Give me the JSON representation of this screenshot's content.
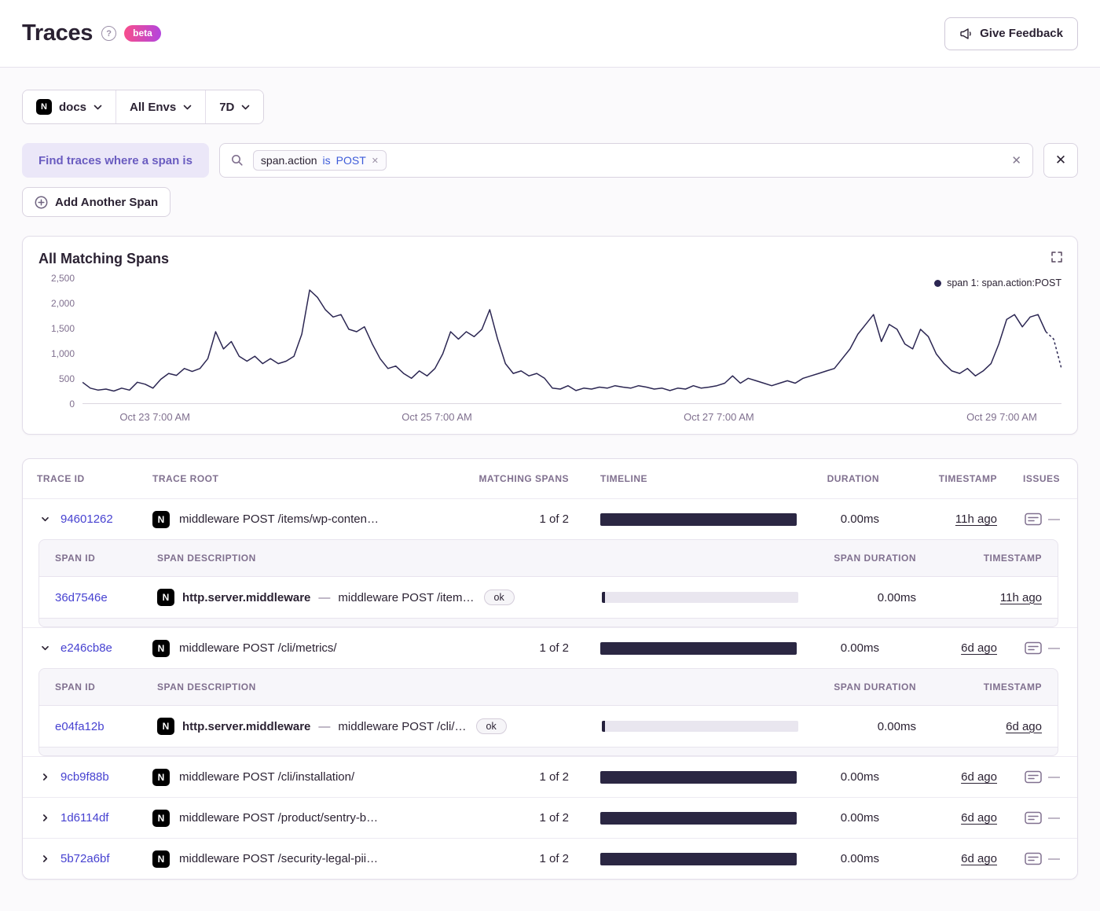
{
  "colors": {
    "accent_purple": "#6a5cc0",
    "link_blue": "#4742d1",
    "timeline_bar": "#2b2743",
    "chart_line": "#2b2652",
    "token_blue": "#3d5bd9",
    "beta_gradient_start": "#f94e8a",
    "beta_gradient_end": "#b245df"
  },
  "header": {
    "title": "Traces",
    "help": "?",
    "beta": "beta",
    "feedback": "Give Feedback"
  },
  "filters": {
    "project": "docs",
    "project_icon": "N",
    "environment": "All Envs",
    "date_range": "7D"
  },
  "span_filter": {
    "label": "Find traces where a span is",
    "token": {
      "key": "span.action",
      "op": "is",
      "value": "POST"
    },
    "add_button": "Add Another Span"
  },
  "chart": {
    "title": "All Matching Spans"
  },
  "chart_data": {
    "type": "line",
    "title": "All Matching Spans",
    "series": [
      {
        "name": "span 1: span.action:POST",
        "values": [
          420,
          300,
          260,
          280,
          240,
          300,
          260,
          420,
          380,
          300,
          480,
          600,
          560,
          700,
          640,
          700,
          900,
          1450,
          1100,
          1250,
          950,
          850,
          950,
          800,
          900,
          800,
          850,
          950,
          1400,
          2300,
          2150,
          1900,
          1750,
          1800,
          1500,
          1450,
          1550,
          1200,
          900,
          700,
          750,
          600,
          500,
          650,
          550,
          700,
          1000,
          1450,
          1300,
          1450,
          1350,
          1500,
          1900,
          1300,
          800,
          600,
          650,
          550,
          600,
          500,
          300,
          280,
          350,
          250,
          300,
          280,
          320,
          300,
          350,
          320,
          300,
          350,
          320,
          280,
          300,
          250,
          300,
          280,
          350,
          300,
          320,
          350,
          400,
          550,
          400,
          500,
          450,
          400,
          350,
          400,
          450,
          400,
          500,
          550,
          600,
          650,
          700,
          900,
          1100,
          1400,
          1600,
          1800,
          1250,
          1600,
          1500,
          1200,
          1100,
          1500,
          1350,
          1000,
          800,
          650,
          600,
          700,
          550,
          650,
          800,
          1200,
          1700,
          1800,
          1550,
          1750,
          1800,
          1450,
          1300,
          700
        ]
      }
    ],
    "ylim": [
      0,
      2500
    ],
    "y_ticks": [
      0,
      500,
      1000,
      1500,
      2000,
      2500
    ],
    "x_tick_labels": [
      "Oct 23 7:00 AM",
      "Oct 25 7:00 AM",
      "Oct 27 7:00 AM",
      "Oct 29 7:00 AM"
    ],
    "x_tick_positions": [
      0.074,
      0.362,
      0.65,
      0.939
    ],
    "grid": false,
    "legend_position": "top-right",
    "line_color": "#2b2652",
    "dashed_tail_points": 3
  },
  "table": {
    "headers": [
      "Trace ID",
      "Trace Root",
      "Matching Spans",
      "Timeline",
      "Duration",
      "Timestamp",
      "Issues"
    ],
    "span_headers": [
      "Span ID",
      "Span Description",
      "Span Duration",
      "Timestamp"
    ],
    "issues_placeholder": "—",
    "description_separator": "—",
    "rows": [
      {
        "id": "94601262",
        "expanded": true,
        "root": "middleware POST /items/wp-conten…",
        "matching": "1 of 2",
        "duration": "0.00ms",
        "timestamp": "11h ago",
        "spans": [
          {
            "id": "36d7546e",
            "op": "http.server.middleware",
            "description": "middleware POST /item…",
            "status": "ok",
            "duration": "0.00ms",
            "timestamp": "11h ago"
          }
        ]
      },
      {
        "id": "e246cb8e",
        "expanded": true,
        "root": "middleware POST /cli/metrics/",
        "matching": "1 of 2",
        "duration": "0.00ms",
        "timestamp": "6d ago",
        "spans": [
          {
            "id": "e04fa12b",
            "op": "http.server.middleware",
            "description": "middleware POST /cli/…",
            "status": "ok",
            "duration": "0.00ms",
            "timestamp": "6d ago"
          }
        ]
      },
      {
        "id": "9cb9f88b",
        "expanded": false,
        "root": "middleware POST /cli/installation/",
        "matching": "1 of 2",
        "duration": "0.00ms",
        "timestamp": "6d ago",
        "spans": []
      },
      {
        "id": "1d6114df",
        "expanded": false,
        "root": "middleware POST /product/sentry-b…",
        "matching": "1 of 2",
        "duration": "0.00ms",
        "timestamp": "6d ago",
        "spans": []
      },
      {
        "id": "5b72a6bf",
        "expanded": false,
        "root": "middleware POST /security-legal-pii…",
        "matching": "1 of 2",
        "duration": "0.00ms",
        "timestamp": "6d ago",
        "spans": []
      }
    ]
  }
}
